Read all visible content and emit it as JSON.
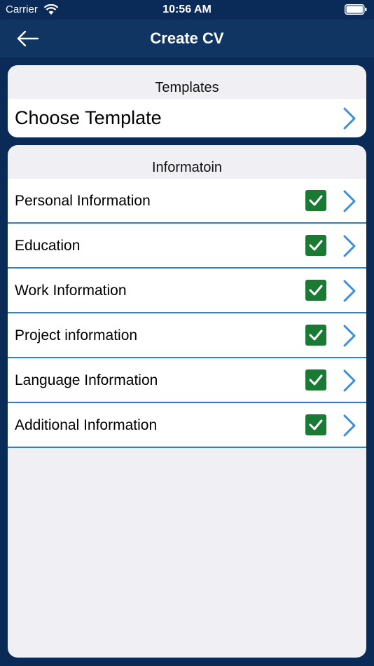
{
  "status_bar": {
    "carrier": "Carrier",
    "time": "10:56 AM"
  },
  "nav": {
    "title": "Create CV",
    "back_icon": "arrow-left-icon"
  },
  "templates": {
    "header": "Templates",
    "row_label": "Choose Template"
  },
  "information": {
    "header": "Informatoin",
    "items": [
      {
        "label": "Personal Information",
        "checked": true
      },
      {
        "label": "Education",
        "checked": true
      },
      {
        "label": "Work Information",
        "checked": true
      },
      {
        "label": "Project information",
        "checked": true
      },
      {
        "label": "Language Information",
        "checked": true
      },
      {
        "label": "Additional Information",
        "checked": true
      }
    ]
  },
  "colors": {
    "background": "#0a2a57",
    "nav_bar": "#103563",
    "card": "#efeff4",
    "separator": "#2b7fd4",
    "check": "#1a7a33",
    "chevron": "#3b8fd9"
  }
}
